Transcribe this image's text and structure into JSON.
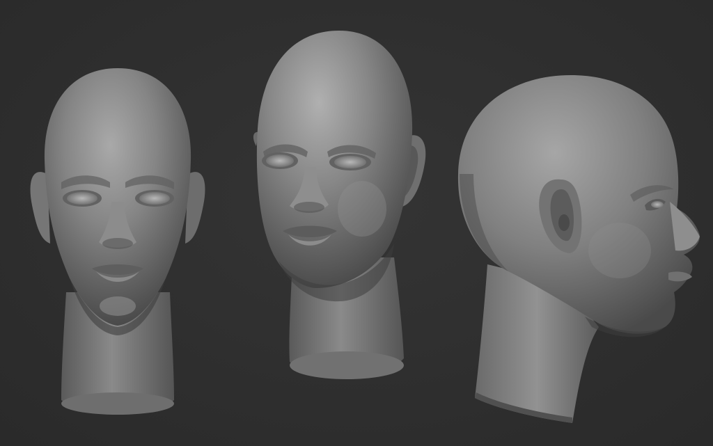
{
  "scene": {
    "background_color": "#2f2f2f",
    "clay_color": "#7d7d7d",
    "views": [
      {
        "name": "front-view",
        "orientation": "front"
      },
      {
        "name": "three-quarter-view",
        "orientation": "three-quarter"
      },
      {
        "name": "side-view",
        "orientation": "profile-right"
      }
    ]
  }
}
